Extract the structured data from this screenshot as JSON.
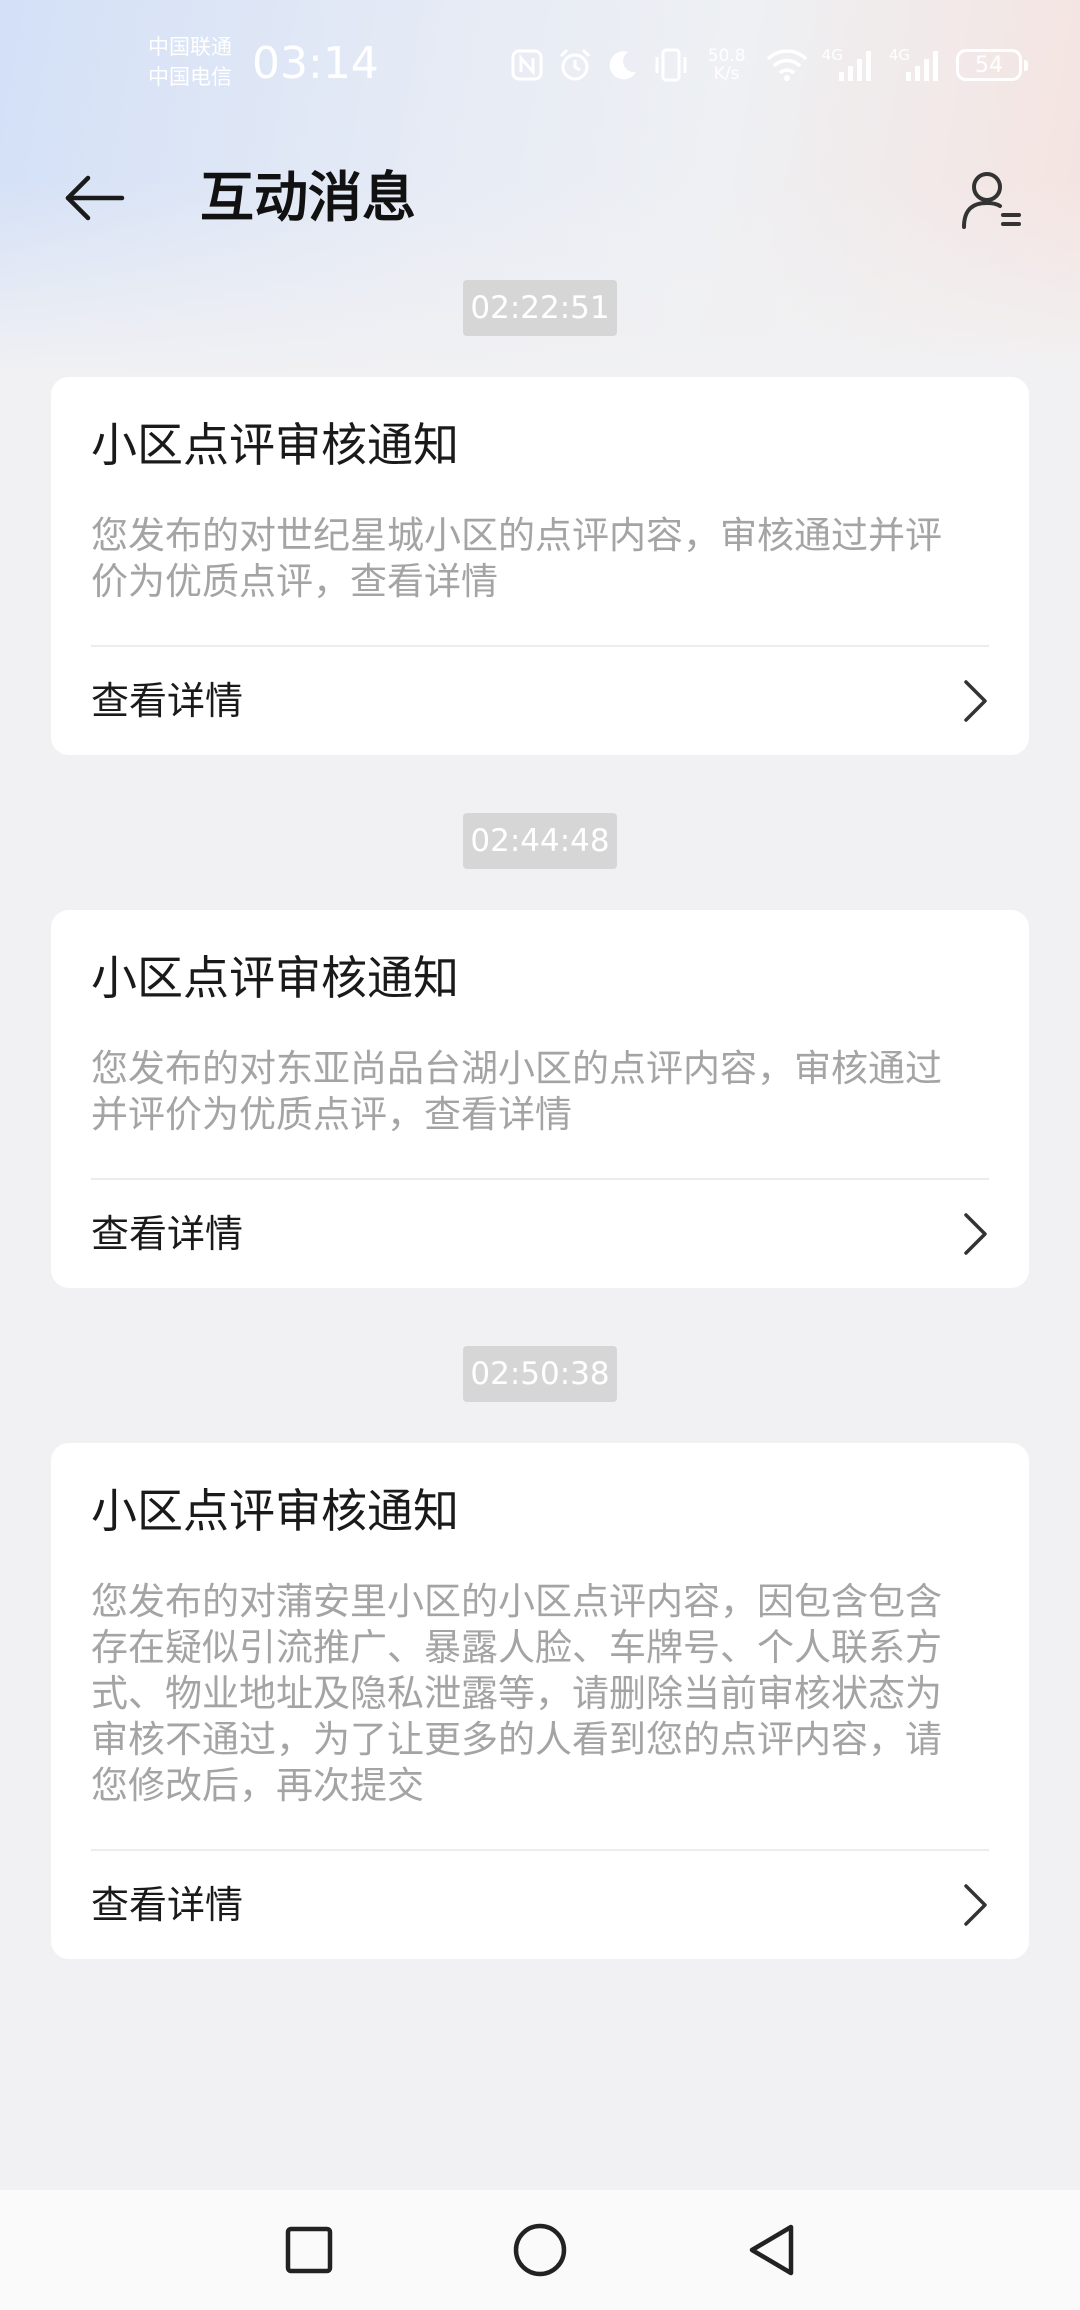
{
  "status_bar": {
    "carrier_1": "中国联通",
    "carrier_2": "中国电信",
    "time": "03:14",
    "net_speed_value": "50.8",
    "net_speed_unit": "K/s",
    "signal_1_label": "4G",
    "signal_2_label": "4G",
    "battery_level": "54",
    "icons": [
      "nfc-icon",
      "alarm-icon",
      "moon-icon",
      "vibrate-icon",
      "wifi-icon",
      "signal-icon",
      "signal-icon",
      "battery-icon"
    ]
  },
  "header": {
    "title": "互动消息",
    "back_icon": "arrow-left-icon",
    "profile_icon": "user-list-icon"
  },
  "messages": [
    {
      "timestamp": "02:22:51",
      "title": "小区点评审核通知",
      "body_lines": [
        "您发布的对世纪星城小区的点评内容，审核通过并评",
        "价为优质点评，查看详情"
      ],
      "action_label": "查看详情"
    },
    {
      "timestamp": "02:44:48",
      "title": "小区点评审核通知",
      "body_lines": [
        "您发布的对东亚尚品台湖小区的点评内容，审核通过",
        "并评价为优质点评，查看详情"
      ],
      "action_label": "查看详情"
    },
    {
      "timestamp": "02:50:38",
      "title": "小区点评审核通知",
      "body_lines": [
        "您发布的对蒲安里小区的小区点评内容，因包含包含",
        "存在疑似引流推广、暴露人脸、车牌号、个人联系方",
        "式、物业地址及隐私泄露等，请删除当前审核状态为",
        "审核不通过，为了让更多的人看到您的点评内容，请",
        "您修改后，再次提交"
      ],
      "action_label": "查看详情"
    }
  ],
  "colors": {
    "background": "#f1f1f3",
    "card": "#ffffff",
    "title_text": "#1a1a1a",
    "body_text": "#a4a4a4",
    "timestamp_bg": "#d6d6d6"
  }
}
